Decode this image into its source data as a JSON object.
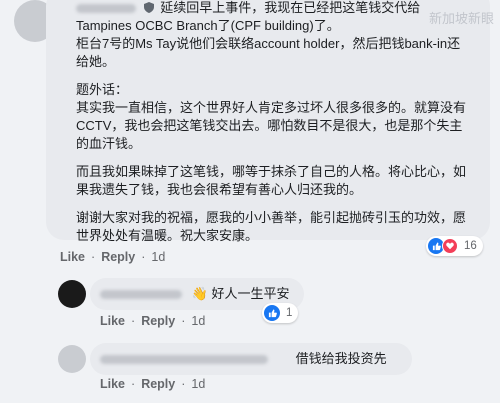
{
  "watermark": "新加坡新眼",
  "main_comment": {
    "line1": "延续回早上事件，我现在已经把这笔钱交代给",
    "line2": "Tampines OCBC Branch了(CPF building)了。",
    "line3": "柜台7号的Ms Tay说他们会联络account holder，然后把钱bank-in还",
    "line4": "给她。",
    "heading": "题外话：",
    "p2_lines": [
      "其实我一直相信，这个世界好人肯定多过坏人很多很多的。就算没有",
      "CCTV，我也会把这笔钱交出去。哪怕数目不是很大，也是那个失主",
      "的血汗钱。"
    ],
    "p3_lines": [
      "而且我如果昧掉了这笔钱，哪等于抹杀了自己的人格。将心比心，如",
      "果我遗失了钱，我也会很希望有善心人归还我的。"
    ],
    "p4_lines": [
      "谢谢大家对我的祝福，愿我的小小善举，能引起抛砖引玉的功效，愿",
      "世界处处有温暖。祝大家安康。"
    ],
    "reaction_count": "16",
    "actions": {
      "like": "Like",
      "reply": "Reply",
      "time": "1d"
    }
  },
  "reply1": {
    "wave_icon": "waving-hand",
    "text": "好人一生平安",
    "reaction_count": "1",
    "actions": {
      "like": "Like",
      "reply": "Reply",
      "time": "1d"
    }
  },
  "reply2": {
    "text": "借钱给我投资先",
    "actions": {
      "like": "Like",
      "reply": "Reply",
      "time": "1d"
    }
  },
  "colors": {
    "like_blue": "#1877f2",
    "love_red": "#f33e58",
    "bubble": "#e8eaee",
    "background": "#f0f2f5"
  }
}
